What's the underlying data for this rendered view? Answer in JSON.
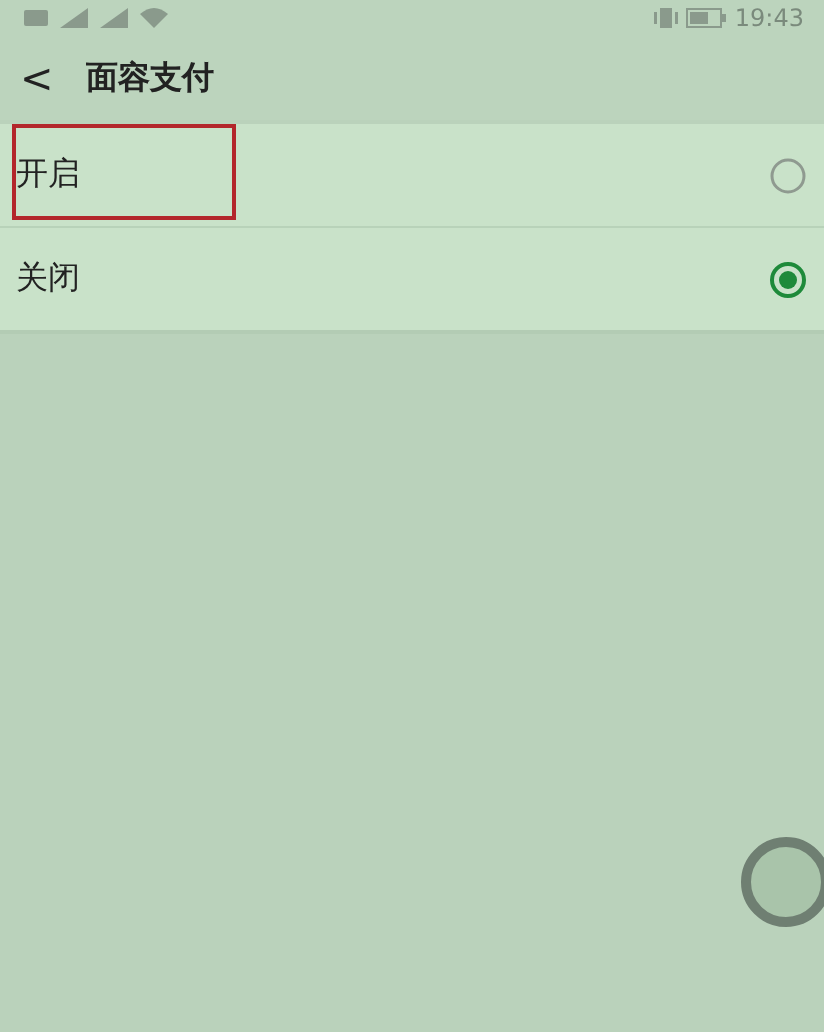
{
  "status_bar": {
    "time": "19:43"
  },
  "header": {
    "back": "<",
    "title": "面容支付"
  },
  "options": [
    {
      "label": "开启",
      "selected": false,
      "highlighted": true
    },
    {
      "label": "关闭",
      "selected": true,
      "highlighted": false
    }
  ]
}
